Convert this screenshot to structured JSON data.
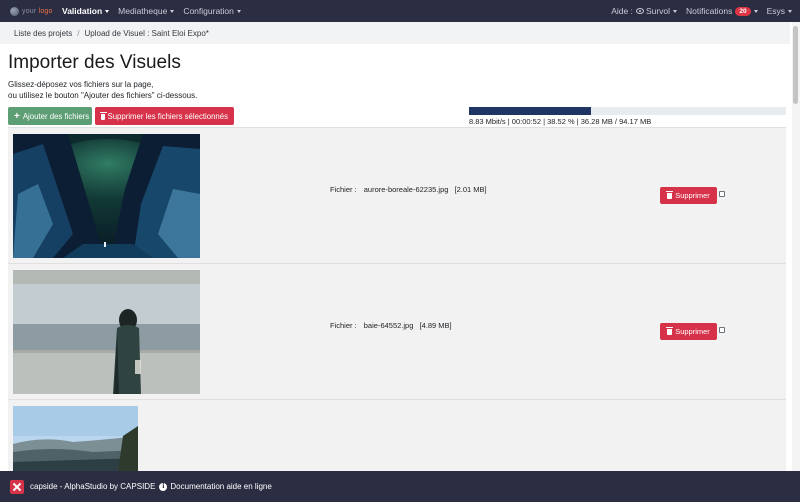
{
  "navbar": {
    "logo_prefix": "your",
    "logo_accent": "logo",
    "items": [
      {
        "label": "Validation"
      },
      {
        "label": "Mediatheque"
      },
      {
        "label": "Configuration"
      }
    ],
    "help_label": "Aide :",
    "help_mode": "Survol",
    "notifications_label": "Notifications",
    "notifications_count": "20",
    "user_label": "Esys"
  },
  "breadcrumb": {
    "projects_link": "Liste des projets",
    "separator": "/",
    "current": "Upload de Visuel : Saint Eloi Expo*"
  },
  "page": {
    "title": "Importer des Visuels",
    "instruction_line1": "Glissez-déposez vos fichiers sur la page,",
    "instruction_line2": "ou utilisez le bouton \"Ajouter des fichiers\" ci-dessous.",
    "add_button_label": "Ajouter des fichiers",
    "remove_selected_label": "Supprimer les fichiers sélectionnés"
  },
  "upload_progress": {
    "fraction": 0.3852,
    "status_text": "8.83 Mbit/s | 00:00:52 | 38.52 % | 36.28 MB / 94.17 MB"
  },
  "files": [
    {
      "label": "Fichier :",
      "name": "aurore-boreale-62235.jpg",
      "size": "[2.01 MB]",
      "delete_label": "Supprimer"
    },
    {
      "label": "Fichier :",
      "name": "baie-64552.jpg",
      "size": "[4.89 MB]",
      "delete_label": "Supprimer"
    }
  ],
  "footer": {
    "brand": "capside - AlphaStudio by CAPSIDE",
    "doc_link": "Documentation aide en ligne"
  },
  "colors": {
    "navbar_bg": "#2b2d42",
    "success": "#5e9e74",
    "danger": "#d6334a",
    "progress": "#1f3564"
  }
}
